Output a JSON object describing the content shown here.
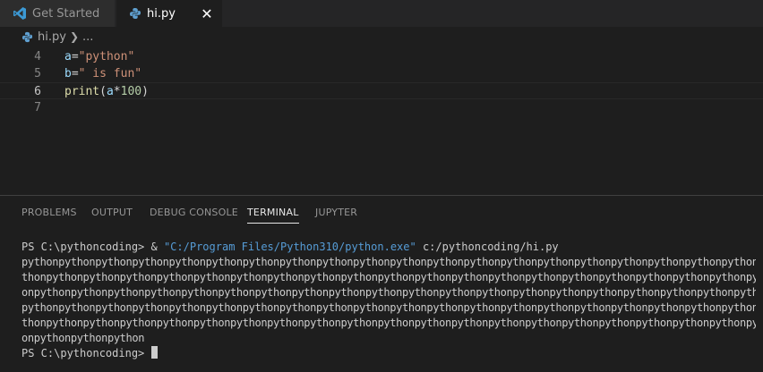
{
  "tabs": [
    {
      "label": "Get Started",
      "icon": "vscode-logo-icon",
      "active": false
    },
    {
      "label": "hi.py",
      "icon": "python-file-icon",
      "active": true
    }
  ],
  "breadcrumb": {
    "file": "hi.py",
    "more": "..."
  },
  "editor": {
    "lines": [
      {
        "number": "4",
        "code": [
          {
            "t": "var",
            "v": "a"
          },
          {
            "t": "op",
            "v": "="
          },
          {
            "t": "str",
            "v": "\"python\""
          }
        ]
      },
      {
        "number": "5",
        "code": [
          {
            "t": "var",
            "v": "b"
          },
          {
            "t": "op",
            "v": "="
          },
          {
            "t": "str",
            "v": "\" is fun\""
          }
        ]
      },
      {
        "number": "6",
        "code": [
          {
            "t": "fn",
            "v": "print"
          },
          {
            "t": "op",
            "v": "("
          },
          {
            "t": "var",
            "v": "a"
          },
          {
            "t": "op",
            "v": "*"
          },
          {
            "t": "num",
            "v": "100"
          },
          {
            "t": "op",
            "v": ")"
          }
        ],
        "current": true
      },
      {
        "number": "7",
        "code": []
      }
    ]
  },
  "panel": {
    "tabs": [
      "PROBLEMS",
      "OUTPUT",
      "DEBUG CONSOLE",
      "TERMINAL",
      "JUPYTER"
    ],
    "active_tab": "TERMINAL"
  },
  "terminal": {
    "prompt1": "PS C:\\pythoncoding> & ",
    "exe": "\"C:/Program Files/Python310/python.exe\"",
    "script": " c:/pythoncoding/hi.py",
    "output_lines": [
      "pythonpythonpythonpythonpythonpythonpythonpythonpythonpythonpythonpythonpythonpythonpythonpythonpythonpythonpythonpythonpythonpythonpythonpy",
      "thonpythonpythonpythonpythonpythonpythonpythonpythonpythonpythonpythonpythonpythonpythonpythonpythonpythonpythonpythonpythonpythonpythonpyth",
      "onpythonpythonpythonpythonpythonpythonpythonpythonpythonpythonpythonpythonpythonpythonpythonpythonpythonpythonpythonpythonpythonpythonpython",
      "pythonpythonpythonpythonpythonpythonpythonpythonpythonpythonpythonpythonpythonpythonpythonpythonpythonpythonpythonpythonpythonpythonpythonpy",
      "thonpythonpythonpythonpythonpythonpythonpythonpythonpythonpythonpythonpythonpythonpythonpythonpythonpythonpythonpythonpythonpythonpythonpyth",
      "onpythonpythonpython"
    ],
    "prompt2": "PS C:\\pythoncoding> "
  }
}
